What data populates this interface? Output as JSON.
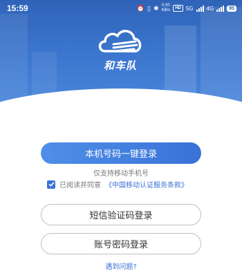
{
  "status_bar": {
    "time": "15:59",
    "net_speed_value": "0.00",
    "net_speed_unit": "KB/s",
    "hd_label": "HD",
    "network_5g": "5G",
    "network_4g": "4G",
    "battery": "95",
    "icons": [
      "alarm-icon",
      "vibrate-icon",
      "bluetooth-icon",
      "signal-icon"
    ]
  },
  "logo": {
    "text": "和车队"
  },
  "login": {
    "onekey_label": "本机号码一键登录",
    "hint": "仅支持移动手机号",
    "agree_prefix": "已阅读并同意",
    "agree_link": "《中国移动认证服务条款》",
    "agree_checked": true,
    "sms_label": "短信验证码登录",
    "password_label": "账号密码登录",
    "help_label": "遇到问题?"
  },
  "colors": {
    "brand": "#3a72d8",
    "header_top": "#2f63b8",
    "muted_text": "#777777",
    "button_border": "#bfbfbf"
  }
}
